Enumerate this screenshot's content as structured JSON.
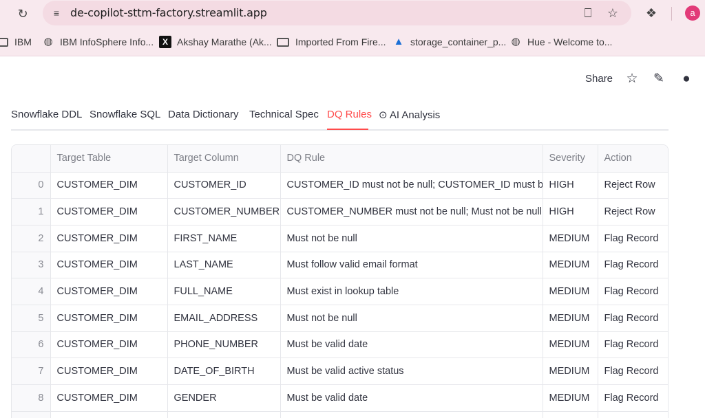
{
  "browser": {
    "url": "de-copilot-sttm-factory.streamlit.app",
    "avatar_letter": "a",
    "bookmarks": [
      {
        "label": "IBM",
        "icon": "folder-icon"
      },
      {
        "label": "IBM InfoSphere Info...",
        "icon": "globe-icon"
      },
      {
        "label": "Akshay Marathe (Ak...",
        "icon": "x-logo-icon"
      },
      {
        "label": "Imported From Fire...",
        "icon": "folder-icon"
      },
      {
        "label": "storage_container_p...",
        "icon": "azure-icon"
      },
      {
        "label": "Hue - Welcome to...",
        "icon": "globe-icon"
      }
    ]
  },
  "header": {
    "share_label": "Share"
  },
  "tabs": [
    {
      "label": "Snowflake DDL",
      "active": false
    },
    {
      "label": "Snowflake SQL",
      "active": false
    },
    {
      "label": "Data Dictionary",
      "active": false
    },
    {
      "label": "Technical Spec",
      "active": false
    },
    {
      "label": "DQ Rules",
      "active": true
    },
    {
      "label": "⊙ AI Analysis",
      "active": false
    }
  ],
  "table": {
    "columns": [
      "",
      "Target Table",
      "Target Column",
      "DQ Rule",
      "Severity",
      "Action"
    ],
    "rows": [
      [
        "0",
        "CUSTOMER_DIM",
        "CUSTOMER_ID",
        "CUSTOMER_ID must not be null; CUSTOMER_ID must be unique",
        "HIGH",
        "Reject Row"
      ],
      [
        "1",
        "CUSTOMER_DIM",
        "CUSTOMER_NUMBER",
        "CUSTOMER_NUMBER must not be null; Must not be null",
        "HIGH",
        "Reject Row"
      ],
      [
        "2",
        "CUSTOMER_DIM",
        "FIRST_NAME",
        "Must not be null",
        "MEDIUM",
        "Flag Record"
      ],
      [
        "3",
        "CUSTOMER_DIM",
        "LAST_NAME",
        "Must follow valid email format",
        "MEDIUM",
        "Flag Record"
      ],
      [
        "4",
        "CUSTOMER_DIM",
        "FULL_NAME",
        "Must exist in lookup table",
        "MEDIUM",
        "Flag Record"
      ],
      [
        "5",
        "CUSTOMER_DIM",
        "EMAIL_ADDRESS",
        "Must not be null",
        "MEDIUM",
        "Flag Record"
      ],
      [
        "6",
        "CUSTOMER_DIM",
        "PHONE_NUMBER",
        "Must be valid date",
        "MEDIUM",
        "Flag Record"
      ],
      [
        "7",
        "CUSTOMER_DIM",
        "DATE_OF_BIRTH",
        "Must be valid active status",
        "MEDIUM",
        "Flag Record"
      ],
      [
        "8",
        "CUSTOMER_DIM",
        "GENDER",
        "Must be valid date",
        "MEDIUM",
        "Flag Record"
      ],
      [
        "",
        "",
        "",
        "",
        "",
        ""
      ]
    ]
  },
  "colors": {
    "accent": "#ff4b4b",
    "chrome_bg": "#f8e9ee",
    "omnibox_bg": "#f4dbe3",
    "avatar_bg": "#e23a78"
  }
}
